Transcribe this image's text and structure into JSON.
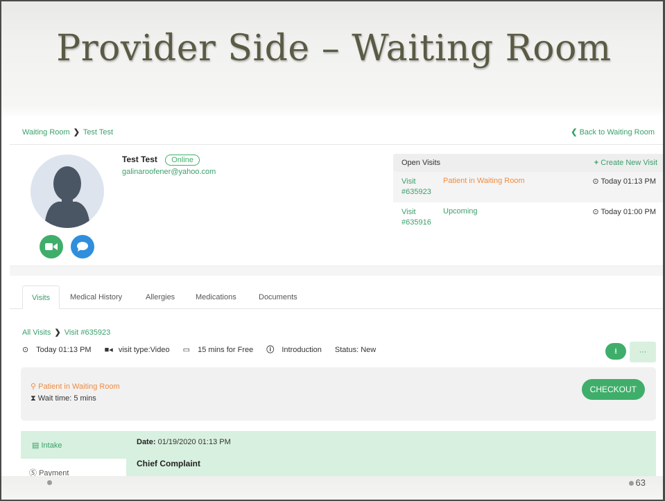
{
  "slide": {
    "title": "Provider Side – Waiting Room",
    "page_number": "63"
  },
  "topbar": {
    "breadcrumb_root": "Waiting Room",
    "breadcrumb_current": "Test Test",
    "back_link": "Back to Waiting Room"
  },
  "patient": {
    "name": "Test Test",
    "status": "Online",
    "email": "galinaroofener@yahoo.com"
  },
  "open_visits": {
    "title": "Open Visits",
    "create_label": "Create New Visit",
    "rows": [
      {
        "visit": "Visit",
        "id": "#635923",
        "status": "Patient in Waiting Room",
        "time": "Today 01:13 PM"
      },
      {
        "visit": "Visit",
        "id": "#635916",
        "status": "Upcoming",
        "time": "Today 01:00 PM"
      }
    ]
  },
  "tabs": [
    "Visits",
    "Medical History",
    "Allergies",
    "Medications",
    "Documents"
  ],
  "visit_detail": {
    "crumb_root": "All Visits",
    "crumb_current": "Visit #635923",
    "time": "Today 01:13 PM",
    "visit_type": "visit type:Video",
    "duration": "15 mins for Free",
    "reason": "Introduction",
    "status": "Status: New",
    "more_label": "···"
  },
  "waiting_status": {
    "location": "Patient in Waiting Room",
    "wait_time": "Wait time: 5 mins",
    "checkout_label": "CHECKOUT"
  },
  "intake": {
    "side_label": "Intake",
    "payment_label": "Payment",
    "date_label": "Date:",
    "date_value": "01/19/2020 01:13 PM",
    "chief_complaint_label": "Chief Complaint"
  },
  "colors": {
    "accent_green": "#3fae6a",
    "status_orange": "#ef8b3f",
    "chat_blue": "#2f8fdc"
  }
}
